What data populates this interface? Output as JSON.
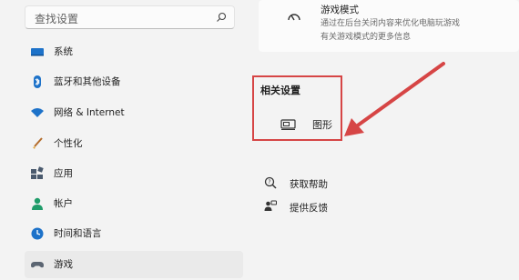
{
  "search": {
    "placeholder": "查找设置"
  },
  "sidebar": {
    "items": [
      {
        "label": "系统",
        "icon": "system-icon"
      },
      {
        "label": "蓝牙和其他设备",
        "icon": "bluetooth-icon"
      },
      {
        "label": "网络 & Internet",
        "icon": "network-icon"
      },
      {
        "label": "个性化",
        "icon": "personalization-icon"
      },
      {
        "label": "应用",
        "icon": "apps-icon"
      },
      {
        "label": "帐户",
        "icon": "account-icon"
      },
      {
        "label": "时间和语言",
        "icon": "time-language-icon"
      },
      {
        "label": "游戏",
        "icon": "gaming-icon",
        "selected": true
      }
    ]
  },
  "game_mode": {
    "title": "游戏模式",
    "description": "通过在后台关闭内容来优化电脑玩游戏",
    "link": "有关游戏模式的更多信息"
  },
  "related": {
    "title": "相关设置",
    "graphics_label": "图形"
  },
  "help": {
    "get_help": "获取帮助",
    "feedback": "提供反馈"
  },
  "colors": {
    "highlight_box": "#d64545",
    "accent": "#0067c0"
  }
}
